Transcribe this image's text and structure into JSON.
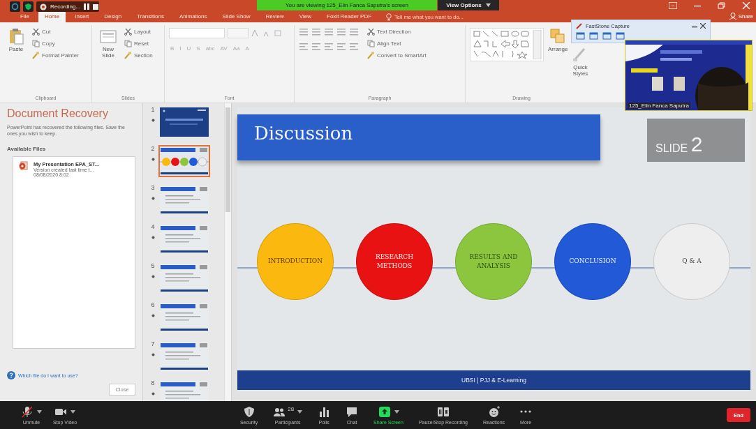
{
  "zoom_header": {
    "recording_label": "Recording...",
    "viewing_banner": "You are viewing 125_Elin Fanca Saputra's screen",
    "view_options": "View Options"
  },
  "ribbon": {
    "tabs": [
      {
        "label": "File",
        "selected": false
      },
      {
        "label": "Home",
        "selected": true
      },
      {
        "label": "Insert",
        "selected": false
      },
      {
        "label": "Design",
        "selected": false
      },
      {
        "label": "Transitions",
        "selected": false
      },
      {
        "label": "Animations",
        "selected": false
      },
      {
        "label": "Slide Show",
        "selected": false
      },
      {
        "label": "Review",
        "selected": false
      },
      {
        "label": "View",
        "selected": false
      },
      {
        "label": "Foxit Reader PDF",
        "selected": false
      }
    ],
    "tell_me": {
      "placeholder": "Tell me what you want to do..."
    },
    "share": "Share",
    "groups": [
      {
        "label": "Clipboard",
        "items": [
          {
            "kind": "big",
            "label": "Paste"
          },
          {
            "kind": "small",
            "label": "Cut"
          },
          {
            "kind": "small",
            "label": "Copy"
          },
          {
            "kind": "small",
            "label": "Format Painter"
          }
        ]
      },
      {
        "label": "Slides",
        "items": [
          {
            "kind": "big",
            "label": "New Slide"
          },
          {
            "kind": "small",
            "label": "Layout"
          },
          {
            "kind": "small",
            "label": "Reset"
          },
          {
            "kind": "small",
            "label": "Section"
          }
        ]
      },
      {
        "label": "Font",
        "items": [
          {
            "kind": "font",
            "buttons": [
              "B",
              "I",
              "U",
              "S",
              "abc",
              "AV",
              "Aa",
              "A"
            ]
          }
        ]
      },
      {
        "label": "Paragraph",
        "items": [
          {
            "kind": "para"
          },
          {
            "kind": "small",
            "label": "Text Direction"
          },
          {
            "kind": "small",
            "label": "Align Text"
          },
          {
            "kind": "small",
            "label": "Convert to SmartArt"
          }
        ]
      },
      {
        "label": "Drawing",
        "items": [
          {
            "kind": "shapes"
          },
          {
            "kind": "big",
            "label": "Arrange"
          },
          {
            "kind": "big",
            "label": "Quick Styles"
          }
        ]
      }
    ]
  },
  "faststone": {
    "title": "FastStone Capture"
  },
  "video_tile": {
    "kind": "picture",
    "name": "125_Elin Fanca Saputra"
  },
  "recovery": {
    "title": "Document Recovery",
    "description": "PowerPoint has recovered the following files.  Save the ones you wish to keep.",
    "available_files": "Available Files",
    "files": [
      {
        "name": "My Presentation EPA_ST...",
        "detail": "Version created last time t...",
        "date": "08/08/2020 8:02"
      }
    ],
    "help": "Which file do I want to use?",
    "close": "Close"
  },
  "thumbnails": [
    {
      "number": "1",
      "kind": "title",
      "selected": false
    },
    {
      "number": "2",
      "kind": "circles",
      "selected": true
    },
    {
      "number": "3",
      "kind": "content",
      "selected": false
    },
    {
      "number": "4",
      "kind": "content",
      "selected": false
    },
    {
      "number": "5",
      "kind": "content",
      "selected": false
    },
    {
      "number": "6",
      "kind": "content",
      "selected": false
    },
    {
      "number": "7",
      "kind": "content",
      "selected": false
    },
    {
      "number": "8",
      "kind": "content",
      "selected": false
    }
  ],
  "slide": {
    "title": "Discussion",
    "badge_word": "SLIDE",
    "badge_number": "2",
    "circles": [
      {
        "label": "INTRODUCTION",
        "color": "#fbb910"
      },
      {
        "label": "RESEARCH METHODS",
        "color": "#e81212"
      },
      {
        "label": "RESULTS AND ANALYSIS",
        "color": "#8cc63f"
      },
      {
        "label": "CONCLUSION",
        "color": "#2159d6"
      },
      {
        "label": "Q & A",
        "color": "#eeeeee"
      }
    ],
    "footer": "UBSI | PJJ & E-Learning"
  },
  "toolbar": {
    "items": [
      {
        "kind": "mic",
        "label": "Unmute"
      },
      {
        "kind": "video",
        "label": "Stop Video"
      },
      {
        "kind": "shield",
        "label": "Security"
      },
      {
        "kind": "people",
        "label": "Participants",
        "count": "28"
      },
      {
        "kind": "polls",
        "label": "Polls"
      },
      {
        "kind": "chat",
        "label": "Chat"
      },
      {
        "kind": "share",
        "label": "Share Screen"
      },
      {
        "kind": "record",
        "label": "Pause/Stop Recording"
      },
      {
        "kind": "reactions",
        "label": "Reactions"
      },
      {
        "kind": "more",
        "label": "More"
      }
    ],
    "end": "End"
  }
}
